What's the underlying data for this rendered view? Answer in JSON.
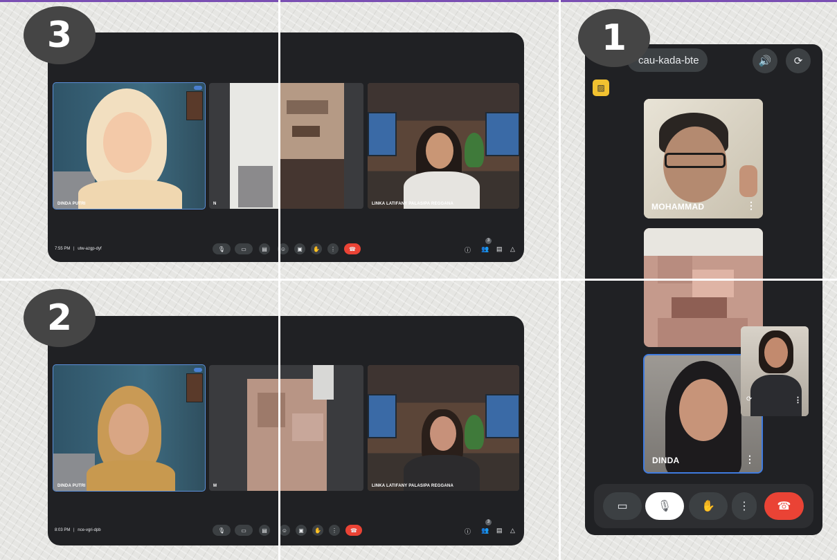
{
  "step_badges": {
    "one": "1",
    "two": "2",
    "three": "3"
  },
  "panel3": {
    "time": "7:55 PM",
    "separator": "|",
    "meeting_code": "utw-azgp-dyf",
    "participants": [
      {
        "name": "DINDA PUTRI"
      },
      {
        "name": "N"
      },
      {
        "name": "LINKA LATIFANY PALASIPA REGGANA"
      }
    ],
    "people_count": "3"
  },
  "panel2": {
    "time": "8:03 PM",
    "separator": "|",
    "meeting_code": "nce-vgri-dpb",
    "participants": [
      {
        "name": "DINDA PUTRI"
      },
      {
        "name": "M"
      },
      {
        "name": "LINKA LATIFANY PALASIPA REGGANA"
      }
    ],
    "people_count": "3"
  },
  "mobile": {
    "meeting_code": "cau-kada-bte",
    "tiles": [
      {
        "name": "MOHAMMAD"
      },
      {
        "name": ""
      },
      {
        "name": "DINDA"
      }
    ]
  },
  "icons": {
    "mic": "mic-icon",
    "camera": "camera-icon",
    "captions": "captions-icon",
    "emoji": "emoji-icon",
    "present": "present-icon",
    "hand": "raise-hand-icon",
    "more": "more-options-icon",
    "end": "end-call-icon",
    "info": "info-icon",
    "people": "people-icon",
    "chat": "chat-icon",
    "activities": "activities-icon",
    "speaker": "speaker-icon",
    "switch_camera": "switch-camera-icon",
    "camera_off": "camera-off-icon",
    "mic_off": "mic-off-icon"
  },
  "colors": {
    "end_call": "#ea4335",
    "active_speaker": "#5b8fd9",
    "window_bg": "#202124",
    "badge": "#454545",
    "top_rule": "#7a4fb3"
  }
}
